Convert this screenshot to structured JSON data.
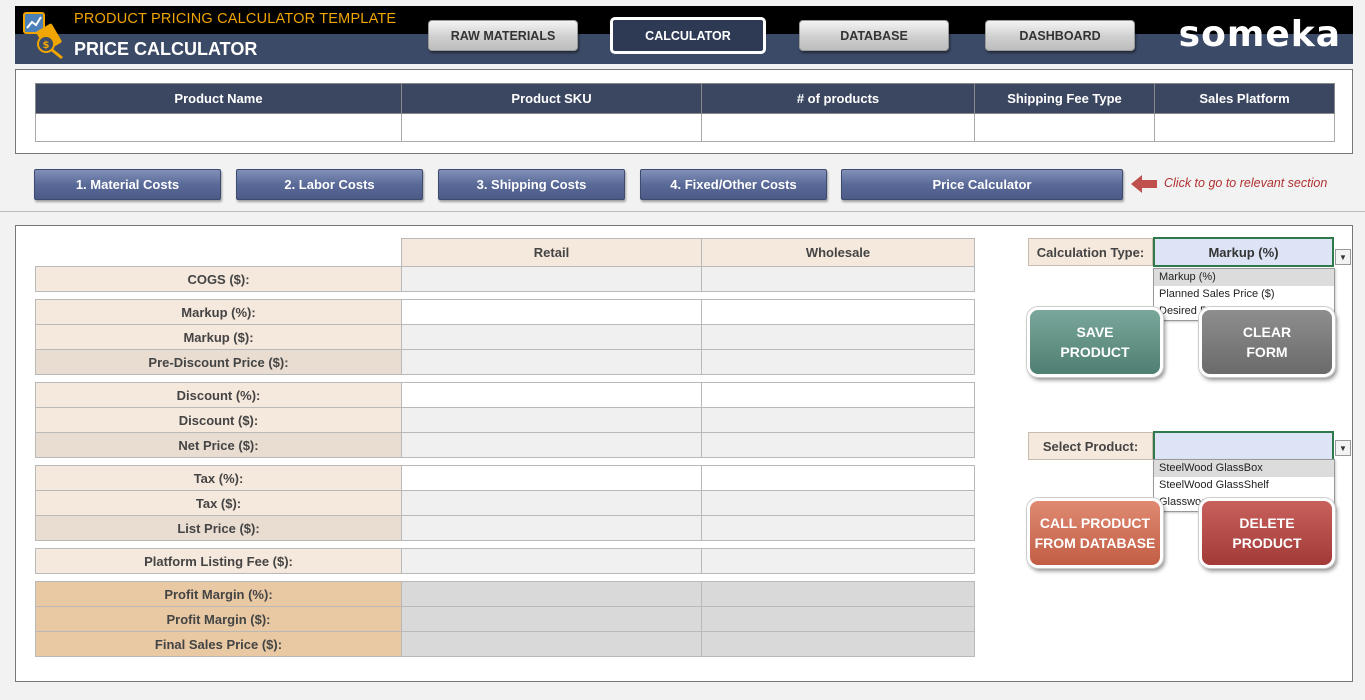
{
  "header": {
    "subtitle": "PRODUCT PRICING CALCULATOR TEMPLATE",
    "title": "PRICE CALCULATOR",
    "brand": "someka",
    "nav": [
      "RAW MATERIALS",
      "CALCULATOR",
      "DATABASE",
      "DASHBOARD"
    ],
    "active_nav": "CALCULATOR"
  },
  "product_info": {
    "columns": [
      "Product Name",
      "Product SKU",
      "# of products",
      "Shipping Fee Type",
      "Sales Platform"
    ],
    "values": [
      "",
      "",
      "",
      "",
      ""
    ]
  },
  "sections": {
    "buttons": [
      "1. Material Costs",
      "2. Labor Costs",
      "3. Shipping Costs",
      "4. Fixed/Other Costs",
      "Price Calculator"
    ],
    "hint": "Click to go to relevant section"
  },
  "calculator": {
    "columns": [
      "Retail",
      "Wholesale"
    ],
    "rows": [
      "COGS ($):",
      "Markup (%):",
      "Markup ($):",
      "Pre-Discount Price ($):",
      "Discount (%):",
      "Discount ($):",
      "Net Price ($):",
      "Tax (%):",
      "Tax ($):",
      "List Price ($):",
      "Platform Listing Fee ($):",
      "Profit Margin (%):",
      "Profit Margin ($):",
      "Final Sales Price ($):"
    ]
  },
  "controls": {
    "calc_type_label": "Calculation Type:",
    "calc_type_value": "Markup (%)",
    "calc_type_options": [
      "Markup (%)",
      "Planned Sales Price ($)",
      "Desired Profit ($)"
    ],
    "select_product_label": "Select Product:",
    "select_product_value": "",
    "product_options": [
      "SteelWood GlassBox",
      "SteelWood GlassShelf",
      "Glasswood Desk"
    ],
    "save_btn": "SAVE\nPRODUCT",
    "clear_btn": "CLEAR\nFORM",
    "call_btn": "CALL PRODUCT\nFROM DATABASE",
    "delete_btn": "DELETE\nPRODUCT"
  },
  "colors": {
    "header_band": "#3b4a66",
    "accent_orange": "#f0a500",
    "section_btn": "#5a6a98",
    "save": "#5f8f82",
    "clear": "#7a7a7a",
    "call": "#d0705a",
    "delete": "#b24a47"
  },
  "icons": {
    "logo": "calculator-money-icon",
    "hint": "arrow-left-icon",
    "dropdown": "caret-down-icon"
  }
}
